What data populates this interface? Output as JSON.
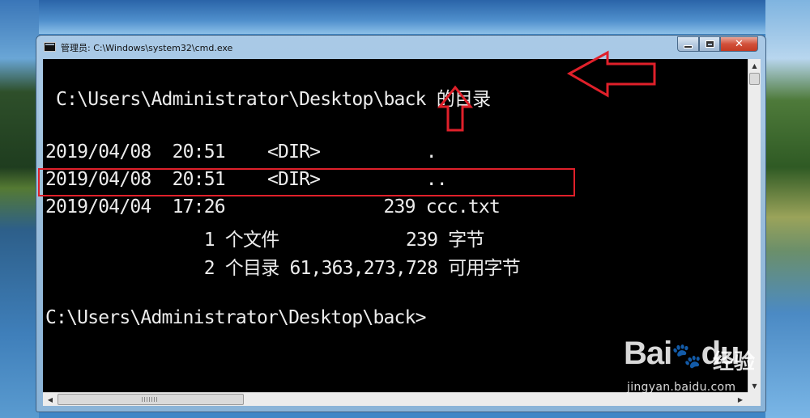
{
  "window": {
    "title": "管理员: C:\\Windows\\system32\\cmd.exe"
  },
  "console": {
    "header": " C:\\Users\\Administrator\\Desktop\\back 的目录",
    "entries": [
      "2019/04/08  20:51    <DIR>          .",
      "2019/04/08  20:51    <DIR>          ..",
      "2019/04/04  17:26               239 ccc.txt"
    ],
    "summary": [
      "               1 个文件            239 字节",
      "               2 个目录 61,363,273,728 可用字节"
    ],
    "prompt": "C:\\Users\\Administrator\\Desktop\\back>"
  },
  "annotation": {
    "color": "#e0202a"
  },
  "watermark": {
    "brand": "Bai",
    "brand2": "du",
    "cn": "经验",
    "url": "jingyan.baidu.com"
  },
  "icons": [
    "cmd-window-icon",
    "minimize-icon",
    "maximize-icon",
    "close-icon",
    "scroll-up-icon",
    "scroll-down-icon",
    "scroll-left-icon",
    "scroll-right-icon",
    "paw-logo-icon"
  ]
}
